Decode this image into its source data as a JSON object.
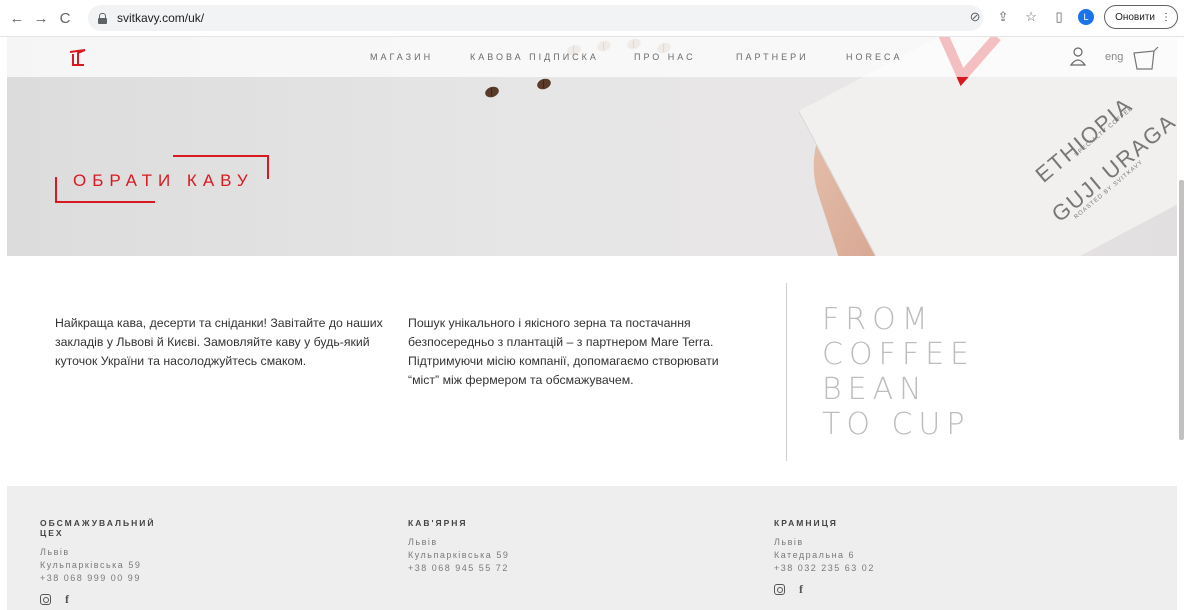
{
  "browser": {
    "url": "svitkavy.com/uk/",
    "update_label": "Оновити",
    "profile_initial": "L"
  },
  "nav": {
    "items": [
      "МАГАЗИН",
      "КАВОВА ПІДПИСКА",
      "ПРО НАС",
      "ПАРТНЕРИ",
      "HORECA"
    ],
    "lang": "eng"
  },
  "hero": {
    "cta_label": "ОБРАТИ КАВУ",
    "bag_line1": "ETHIOPIA",
    "bag_line2": "GUJI URAGA",
    "bag_small1": "SPECIALTY COFFEE",
    "bag_small2": "ROASTED BY SVITKAVY",
    "active_slide": 2,
    "slide_count": 4
  },
  "content": {
    "col1": "Найкраща кава, десерти та сніданки! Завітайте до наших закладів у Львові й Києві. Замовляйте каву у будь-який куточок України та насолоджуйтесь смаком.",
    "col2": "Пошук унікального і якісного зерна та постачання безпосередньо з плантацій – з партнером Mare Terra. Підтримуючи місію компанії, допомагаємо створювати “міст” між фермером та обсмажувачем.",
    "tagline": [
      "FROM",
      "COFFEE",
      "BEAN",
      "TO CUP"
    ]
  },
  "footer": {
    "col1": {
      "title": "ОБСМАЖУВАЛЬНИЙ ЦЕХ",
      "city": "Львів",
      "address": "Кульпарківська 59",
      "phone": "+38 068 999 00 99"
    },
    "col2": {
      "title": "КАВ'ЯРНЯ",
      "city": "Львів",
      "address": "Кульпарківська 59",
      "phone": "+38 068 945 55 72"
    },
    "col3": {
      "title": "КРАМНИЦЯ",
      "city": "Львів",
      "address": "Катедральна 6",
      "phone": "+38 032 235 63 02"
    }
  },
  "colors": {
    "accent": "#d71920",
    "footer_bg": "#eeeeee"
  }
}
